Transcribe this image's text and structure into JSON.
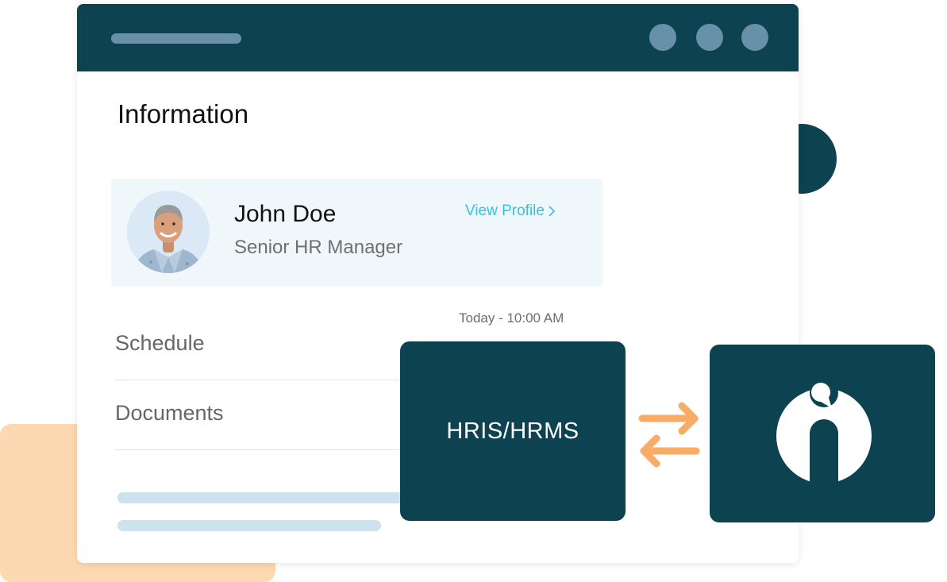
{
  "section": {
    "title": "Information"
  },
  "profile": {
    "name": "John Doe",
    "role": "Senior HR Manager",
    "view_profile_label": "View Profile"
  },
  "schedule": {
    "label": "Schedule",
    "timestamp": "Today - 10:00 AM"
  },
  "documents": {
    "label": "Documents"
  },
  "integration": {
    "source_label": "HRIS/HRMS",
    "icons": [
      "sync-arrows-icon",
      "brand-logo-icon"
    ]
  },
  "colors": {
    "primary": "#0d4350",
    "accent_link": "#38c1dd",
    "accent_arrows": "#f8ac66",
    "peach": "#fdd9b1",
    "card_bg": "#f0f7fb",
    "muted_dot": "#6890a8"
  }
}
